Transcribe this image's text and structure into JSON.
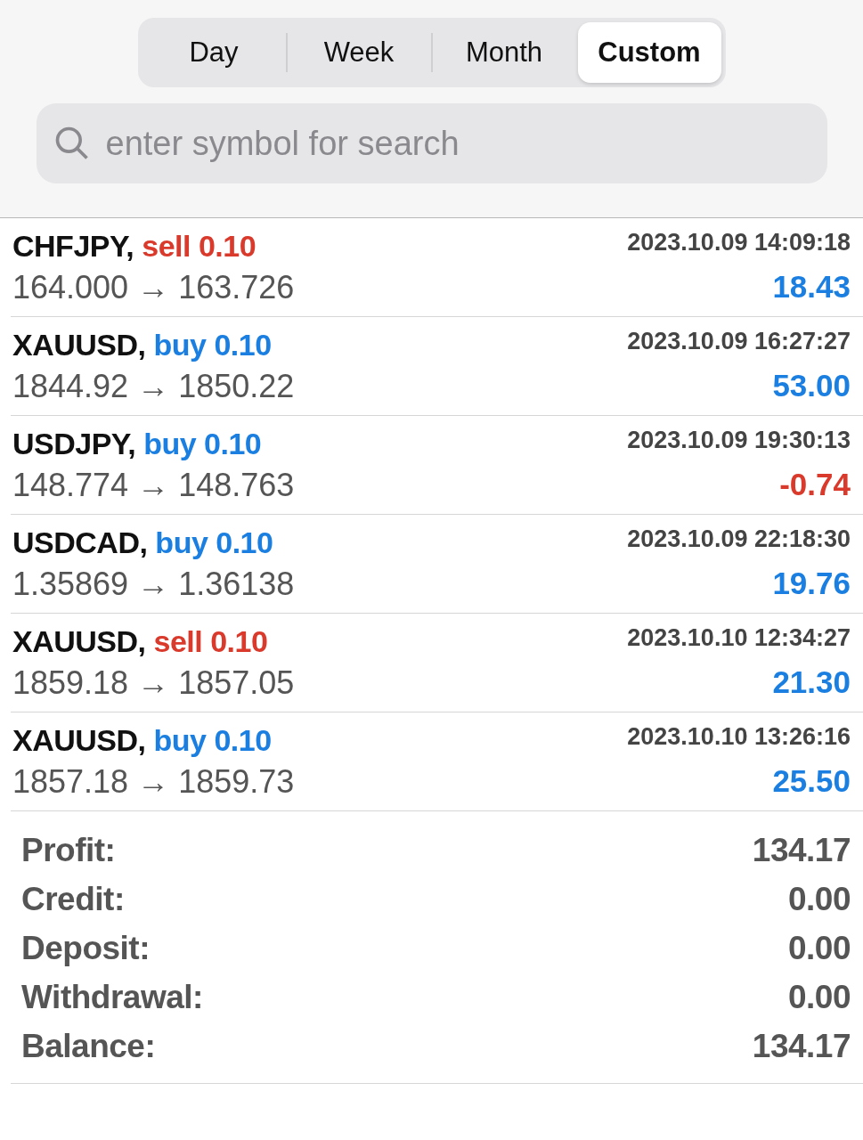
{
  "tabs": [
    {
      "label": "Day",
      "selected": false
    },
    {
      "label": "Week",
      "selected": false
    },
    {
      "label": "Month",
      "selected": false
    },
    {
      "label": "Custom",
      "selected": true
    }
  ],
  "search": {
    "placeholder": "enter symbol for search"
  },
  "deals": [
    {
      "symbol": "CHFJPY,",
      "kind": "sell",
      "side_text": "sell 0.10",
      "time": "2023.10.09 14:09:18",
      "prices": "164.000 → 163.726",
      "profit": "18.43",
      "color": "#1a7fe0"
    },
    {
      "symbol": "XAUUSD,",
      "kind": "buy",
      "side_text": "buy 0.10",
      "time": "2023.10.09 16:27:27",
      "prices": "1844.92 → 1850.22",
      "profit": "53.00",
      "color": "#1a7fe0"
    },
    {
      "symbol": "USDJPY,",
      "kind": "buy",
      "side_text": "buy 0.10",
      "time": "2023.10.09 19:30:13",
      "prices": "148.774 → 148.763",
      "profit": "-0.74",
      "color": "#d93a2b"
    },
    {
      "symbol": "USDCAD,",
      "kind": "buy",
      "side_text": "buy 0.10",
      "time": "2023.10.09 22:18:30",
      "prices": "1.35869 → 1.36138",
      "profit": "19.76",
      "color": "#1a7fe0"
    },
    {
      "symbol": "XAUUSD,",
      "kind": "sell",
      "side_text": "sell 0.10",
      "time": "2023.10.10 12:34:27",
      "prices": "1859.18 → 1857.05",
      "profit": "21.30",
      "color": "#1a7fe0"
    },
    {
      "symbol": "XAUUSD,",
      "kind": "buy",
      "side_text": "buy 0.10",
      "time": "2023.10.10 13:26:16",
      "prices": "1857.18 → 1859.73",
      "profit": "25.50",
      "color": "#1a7fe0"
    }
  ],
  "summary": [
    {
      "label": "Profit:",
      "value": "134.17"
    },
    {
      "label": "Credit:",
      "value": "0.00"
    },
    {
      "label": "Deposit:",
      "value": "0.00"
    },
    {
      "label": "Withdrawal:",
      "value": "0.00"
    },
    {
      "label": "Balance:",
      "value": "134.17"
    }
  ]
}
